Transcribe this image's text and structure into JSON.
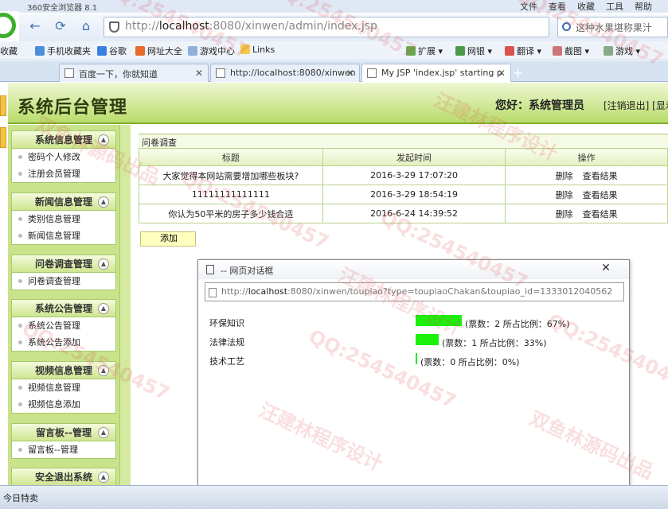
{
  "browser": {
    "app_title": "360安全浏览器 8.1",
    "menus": [
      "文件",
      "查看",
      "收藏",
      "工具",
      "帮助"
    ],
    "url_prefix": "http://",
    "url_host": "localhost",
    "url_rest": ":8080/xinwen/admin/index.jsp",
    "search_placeholder": "这种水果堪称果汁",
    "favorites": [
      "收藏",
      "手机收藏夹",
      "谷歌",
      "网址大全",
      "游戏中心",
      "Links",
      "扩展",
      "网银",
      "翻译",
      "截图",
      "游戏"
    ],
    "tabs": [
      {
        "label": "百度一下，你就知道"
      },
      {
        "label": "http://localhost:8080/xinwen"
      },
      {
        "label": "My JSP 'index.jsp' starting p"
      }
    ],
    "status_text": "今日特卖"
  },
  "header": {
    "title": "系统后台管理",
    "greeting": "您好：系统管理员",
    "links": "[注销退出] [显示"
  },
  "sidebar": {
    "groups": [
      {
        "title": "系统信息管理",
        "items": [
          "密码个人修改",
          "注册会员管理"
        ]
      },
      {
        "title": "新闻信息管理",
        "items": [
          "类别信息管理",
          "新闻信息管理"
        ]
      },
      {
        "title": "问卷调查管理",
        "items": [
          "问卷调查管理"
        ]
      },
      {
        "title": "系统公告管理",
        "items": [
          "系统公告管理",
          "系统公告添加"
        ]
      },
      {
        "title": "视频信息管理",
        "items": [
          "视频信息管理",
          "视频信息添加"
        ]
      },
      {
        "title": "留言板--管理",
        "items": [
          "留言板--管理"
        ]
      },
      {
        "title": "安全退出系统",
        "items": []
      }
    ]
  },
  "main": {
    "panel_title": "问卷调查",
    "columns": [
      "标题",
      "发起时间",
      "操作"
    ],
    "rows": [
      {
        "title": "大家觉得本网站需要增加哪些板块?",
        "time": "2016-3-29 17:07:20",
        "op_delete": "删除",
        "op_view": "查看结果"
      },
      {
        "title": "11111111111111",
        "time": "2016-3-29 18:54:19",
        "op_delete": "删除",
        "op_view": "查看结果"
      },
      {
        "title": "你认为50平米的房子多少钱合适",
        "time": "2016-6-24 14:39:52",
        "op_delete": "删除",
        "op_view": "查看结果"
      }
    ],
    "add_label": "添加"
  },
  "dialog": {
    "title": "-- 网页对话框",
    "url_prefix": "http://",
    "url_host": "localhost",
    "url_rest": ":8080/xinwen/toupiao?type=toupiaoChakan&toupiao_id=1333012040562",
    "options": [
      {
        "name": "环保知识",
        "votes_text": "(票数：2   所占比例：67%)",
        "ratio": 0.67
      },
      {
        "name": "法律法规",
        "votes_text": "(票数：1   所占比例：33%)",
        "ratio": 0.33
      },
      {
        "name": "技术工艺",
        "votes_text": "(票数：0   所占比例：0%)",
        "ratio": 0
      }
    ],
    "bar_color": "#1cf00c"
  },
  "watermarks": [
    "QQ:254540457",
    "汪建林程序设计",
    "双鱼林源码出品"
  ]
}
